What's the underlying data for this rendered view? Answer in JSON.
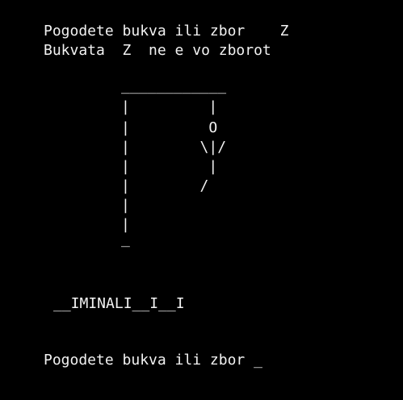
{
  "console": {
    "background_color": "#000000",
    "text_color": "#f2f2f2",
    "lines": {
      "prompt_1": "Pogodete bukva ili zbor    Z",
      "result_1": "Bukvata  Z  ne e vo zborot",
      "gallows_top": "____________",
      "gallows_row_1": "|         |",
      "gallows_row_2": "|         O",
      "gallows_row_3": "|        \\|/",
      "gallows_row_4": "|         |",
      "gallows_row_5": "|        /",
      "gallows_row_6": "|",
      "gallows_row_7": "|",
      "gallows_base": "_",
      "word_progress": "__IMINALI__I__I",
      "prompt_2": "Pogodete bukva ili zbor _"
    }
  }
}
